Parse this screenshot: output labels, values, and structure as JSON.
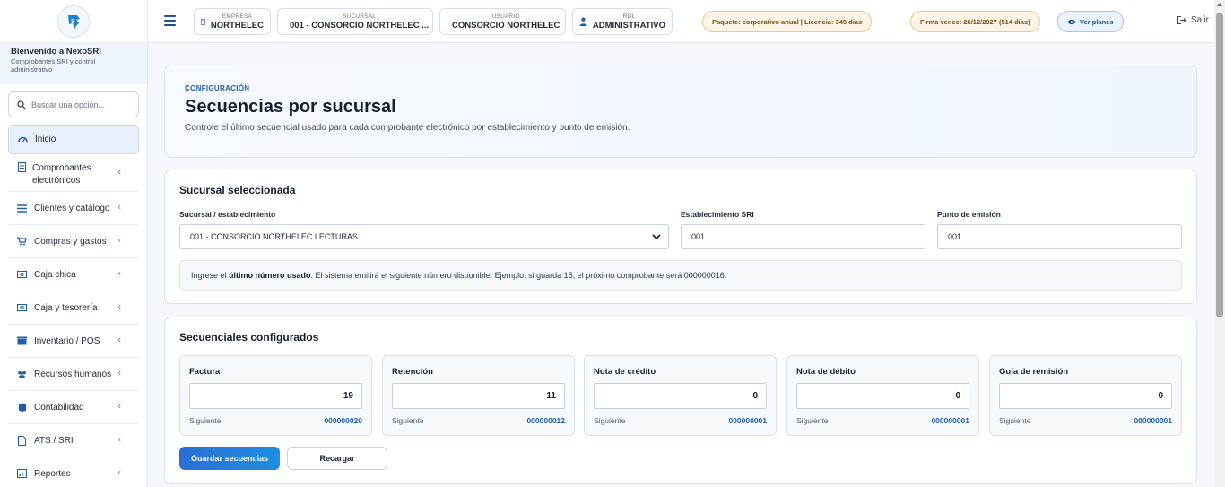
{
  "sidebar": {
    "welcome_title": "Bienvenido a NexoSRI",
    "welcome_subtitle": "Comprobantes SRI y control administrativo",
    "search_placeholder": "Buscar una opción...",
    "items": [
      {
        "label": "Inicio",
        "icon": "dashboard-icon",
        "active": true
      },
      {
        "label": "Comprobantes electrónicos",
        "icon": "document-icon"
      },
      {
        "label": "Clientes y catálogo",
        "icon": "list-icon"
      },
      {
        "label": "Compras y gastos",
        "icon": "cart-icon"
      },
      {
        "label": "Caja chica",
        "icon": "cash-icon"
      },
      {
        "label": "Caja y tesorería",
        "icon": "cash-icon"
      },
      {
        "label": "Inventario / POS",
        "icon": "box-icon"
      },
      {
        "label": "Recursos humanos",
        "icon": "users-icon"
      },
      {
        "label": "Contabilidad",
        "icon": "book-icon"
      },
      {
        "label": "ATS / SRI",
        "icon": "file-icon"
      },
      {
        "label": "Reportes",
        "icon": "chart-icon"
      }
    ]
  },
  "topbar": {
    "empresa_label": "EMPRESA",
    "empresa_value": "NORTHELEC",
    "sucursal_label": "SUCURSAL",
    "sucursal_value": "001 - CONSORCIO NORTHELEC ...",
    "usuario_label": "USUARIO",
    "usuario_value": "CONSORCIO NORTHELEC",
    "rol_label": "ROL",
    "rol_value": "ADMINISTRATIVO",
    "paquete": "Paquete: corporativo anual | Licencia: 345 días",
    "firma": "Firma vence: 26/12/2027 (514 días)",
    "ver_planes": "Ver planes",
    "salir": "Salir"
  },
  "hero": {
    "kicker": "CONFIGURACIÓN",
    "title": "Secuencias por sucursal",
    "description": "Controle el último secuencial usado para cada comprobante electrónico por establecimiento y punto de emisión."
  },
  "seleccion": {
    "title": "Sucursal seleccionada",
    "sucursal_label": "Sucursal / establecimiento",
    "sucursal_value": "001 - CONSORCIO NORTHELEC LECTURAS",
    "establecimiento_label": "Establecimiento SRI",
    "establecimiento_value": "001",
    "punto_label": "Punto de emisión",
    "punto_value": "001",
    "note_pre": "Ingrese el ",
    "note_bold": "último número usado",
    "note_post": ". El sistema emitirá el siguiente número disponible. Ejemplo: si guarda 15, el próximo comprobante será 000000016."
  },
  "secuenciales": {
    "title": "Secuenciales configurados",
    "next_label": "Siguiente",
    "items": [
      {
        "name": "Factura",
        "value": "19",
        "next": "000000020"
      },
      {
        "name": "Retención",
        "value": "11",
        "next": "000000012"
      },
      {
        "name": "Nota de crédito",
        "value": "0",
        "next": "000000001"
      },
      {
        "name": "Nota de débito",
        "value": "0",
        "next": "000000001"
      },
      {
        "name": "Guía de remisión",
        "value": "0",
        "next": "000000001"
      }
    ],
    "save_button": "Guardar secuencias",
    "reload_button": "Recargar"
  },
  "colors": {
    "accent": "#1f5faa",
    "primary_button": "#2a6fd6"
  }
}
